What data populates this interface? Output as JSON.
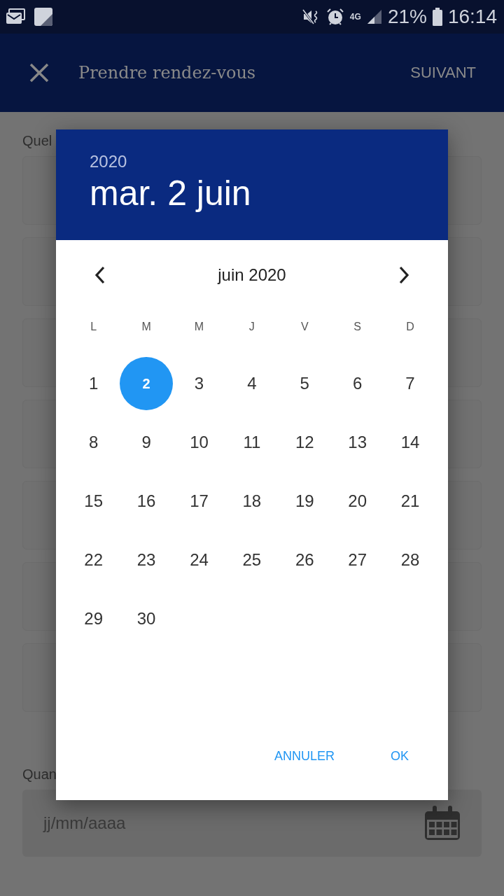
{
  "status_bar": {
    "network": "4G",
    "battery": "21%",
    "time": "16:14"
  },
  "app_bar": {
    "title": "Prendre rendez-vous",
    "action": "SUIVANT"
  },
  "form": {
    "question_1": "Quel",
    "option_cards": [
      {
        "kind": "empty"
      },
      {
        "kind": "empty"
      },
      {
        "kind": "empty"
      },
      {
        "kind": "empty"
      },
      {
        "kind": "empty"
      },
      {
        "kind": "empty"
      },
      {
        "kind": "empty"
      }
    ],
    "question_2": "Quan",
    "date_field": {
      "placeholder": "jj/mm/aaaa"
    }
  },
  "dialog": {
    "year": "2020",
    "date": "mar. 2 juin",
    "month": "juin 2020",
    "weekdays": [
      "L",
      "M",
      "M",
      "J",
      "V",
      "S",
      "D"
    ],
    "days": [
      {
        "label": "1",
        "selected": false
      },
      {
        "label": "2",
        "selected": true
      },
      {
        "label": "3",
        "selected": false
      },
      {
        "label": "4",
        "selected": false
      },
      {
        "label": "5",
        "selected": false
      },
      {
        "label": "6",
        "selected": false
      },
      {
        "label": "7",
        "selected": false
      },
      {
        "label": "8",
        "selected": false
      },
      {
        "label": "9",
        "selected": false
      },
      {
        "label": "10",
        "selected": false
      },
      {
        "label": "11",
        "selected": false
      },
      {
        "label": "12",
        "selected": false
      },
      {
        "label": "13",
        "selected": false
      },
      {
        "label": "14",
        "selected": false
      },
      {
        "label": "15",
        "selected": false
      },
      {
        "label": "16",
        "selected": false
      },
      {
        "label": "17",
        "selected": false
      },
      {
        "label": "18",
        "selected": false
      },
      {
        "label": "19",
        "selected": false
      },
      {
        "label": "20",
        "selected": false
      },
      {
        "label": "21",
        "selected": false
      },
      {
        "label": "22",
        "selected": false
      },
      {
        "label": "23",
        "selected": false
      },
      {
        "label": "24",
        "selected": false
      },
      {
        "label": "25",
        "selected": false
      },
      {
        "label": "26",
        "selected": false
      },
      {
        "label": "27",
        "selected": false
      },
      {
        "label": "28",
        "selected": false
      },
      {
        "label": "29",
        "selected": false
      },
      {
        "label": "30",
        "selected": false
      }
    ],
    "buttons": [
      "ANNULER",
      "OK"
    ]
  }
}
